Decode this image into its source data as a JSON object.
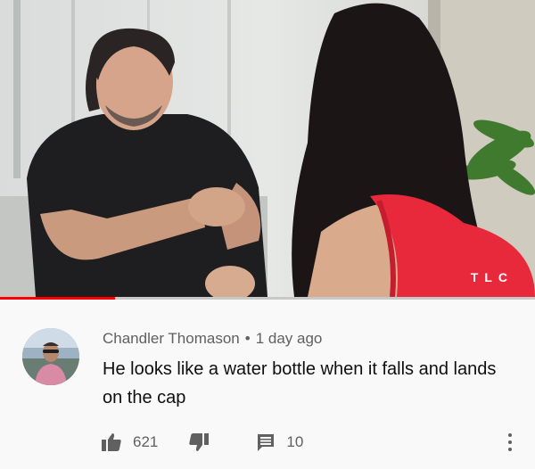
{
  "video": {
    "channel_logo": "TLC",
    "progress_fraction": 0.215
  },
  "comment": {
    "author": "Chandler Thomason",
    "separator": "•",
    "time": "1 day ago",
    "text": "He looks like a water bottle when it falls and lands on the cap",
    "likes": "621",
    "replies": "10",
    "avatar_icon": "user-avatar"
  },
  "icons": {
    "like": "thumbs-up-icon",
    "dislike": "thumbs-down-icon",
    "reply": "reply-icon",
    "more": "more-vertical-icon"
  },
  "colors": {
    "progress": "#ff0000",
    "meta_text": "#606060",
    "body_text": "#0f0f0f",
    "background": "#f9f9f9"
  }
}
